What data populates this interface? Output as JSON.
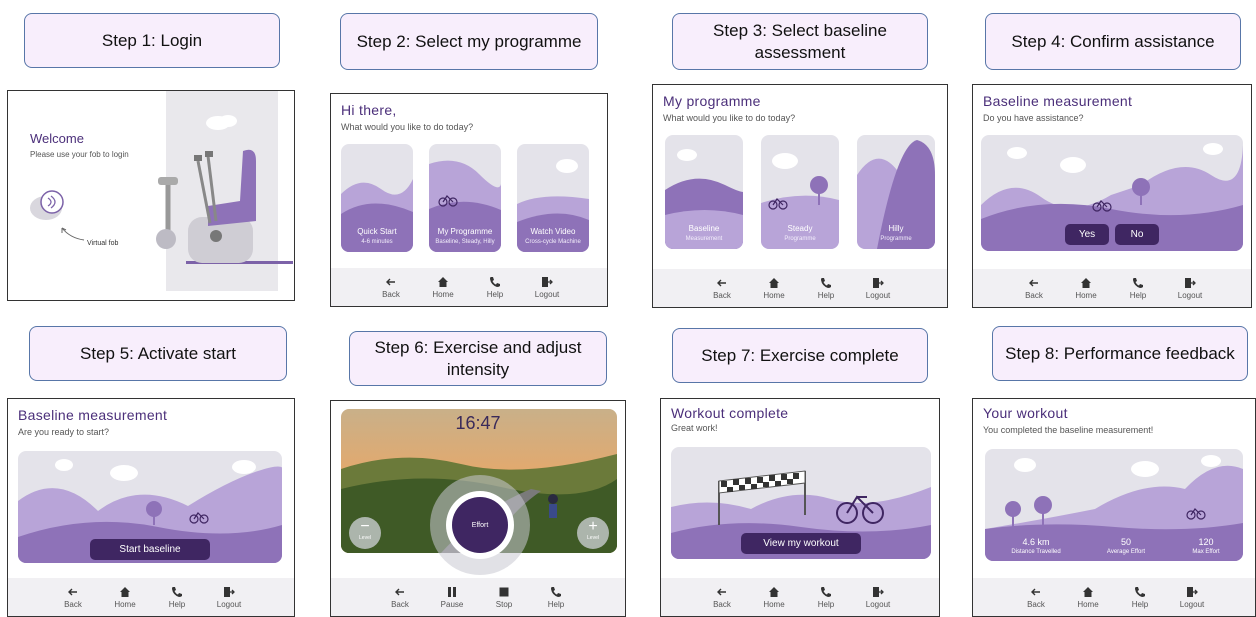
{
  "steps": [
    {
      "label": "Step 1: Login"
    },
    {
      "label": "Step 2: Select my programme"
    },
    {
      "label": "Step 3: Select baseline assessment"
    },
    {
      "label": "Step 4: Confirm assistance"
    },
    {
      "label": "Step 5: Activate start"
    },
    {
      "label": "Step 6: Exercise and adjust intensity"
    },
    {
      "label": "Step 7: Exercise complete"
    },
    {
      "label": "Step 8: Performance feedback"
    }
  ],
  "nav": {
    "back": "Back",
    "home": "Home",
    "help": "Help",
    "logout": "Logout",
    "pause": "Pause",
    "stop": "Stop"
  },
  "s1": {
    "title": "Welcome",
    "sub": "Please use your fob to login",
    "fob": "Virtual fob"
  },
  "s2": {
    "title": "Hi there,",
    "sub": "What would you like to do today?",
    "cards": [
      {
        "label": "Quick Start",
        "sub": "4-6 minutes"
      },
      {
        "label": "My Programme",
        "sub": "Baseline, Steady, Hilly"
      },
      {
        "label": "Watch Video",
        "sub": "Cross-cycle Machine"
      }
    ]
  },
  "s3": {
    "title": "My programme",
    "sub": "What would you like to do today?",
    "cards": [
      {
        "label": "Baseline",
        "sub": "Measurement"
      },
      {
        "label": "Steady",
        "sub": "Programme"
      },
      {
        "label": "Hilly",
        "sub": "Programme"
      }
    ]
  },
  "s4": {
    "title": "Baseline measurement",
    "sub": "Do you have assistance?",
    "yes": "Yes",
    "no": "No"
  },
  "s5": {
    "title": "Baseline measurement",
    "sub": "Are you ready to start?",
    "button": "Start baseline"
  },
  "s6": {
    "time": "16:47",
    "effort": "Effort",
    "level_down": "Level",
    "level_up": "Level"
  },
  "s7": {
    "title": "Workout complete",
    "sub": "Great work!",
    "button": "View my workout"
  },
  "s8": {
    "title": "Your workout",
    "sub": "You completed the baseline measurement!",
    "stats": [
      {
        "value": "4.6 km",
        "label": "Distance Travelled"
      },
      {
        "value": "50",
        "label": "Average Effort"
      },
      {
        "value": "120",
        "label": "Max Effort"
      }
    ]
  },
  "colors": {
    "purple_dark": "#3f2662",
    "purple_mid": "#8e72b8",
    "purple_light": "#b8a4d8",
    "step_fill": "#f8eefc",
    "step_border": "#5876a8"
  }
}
